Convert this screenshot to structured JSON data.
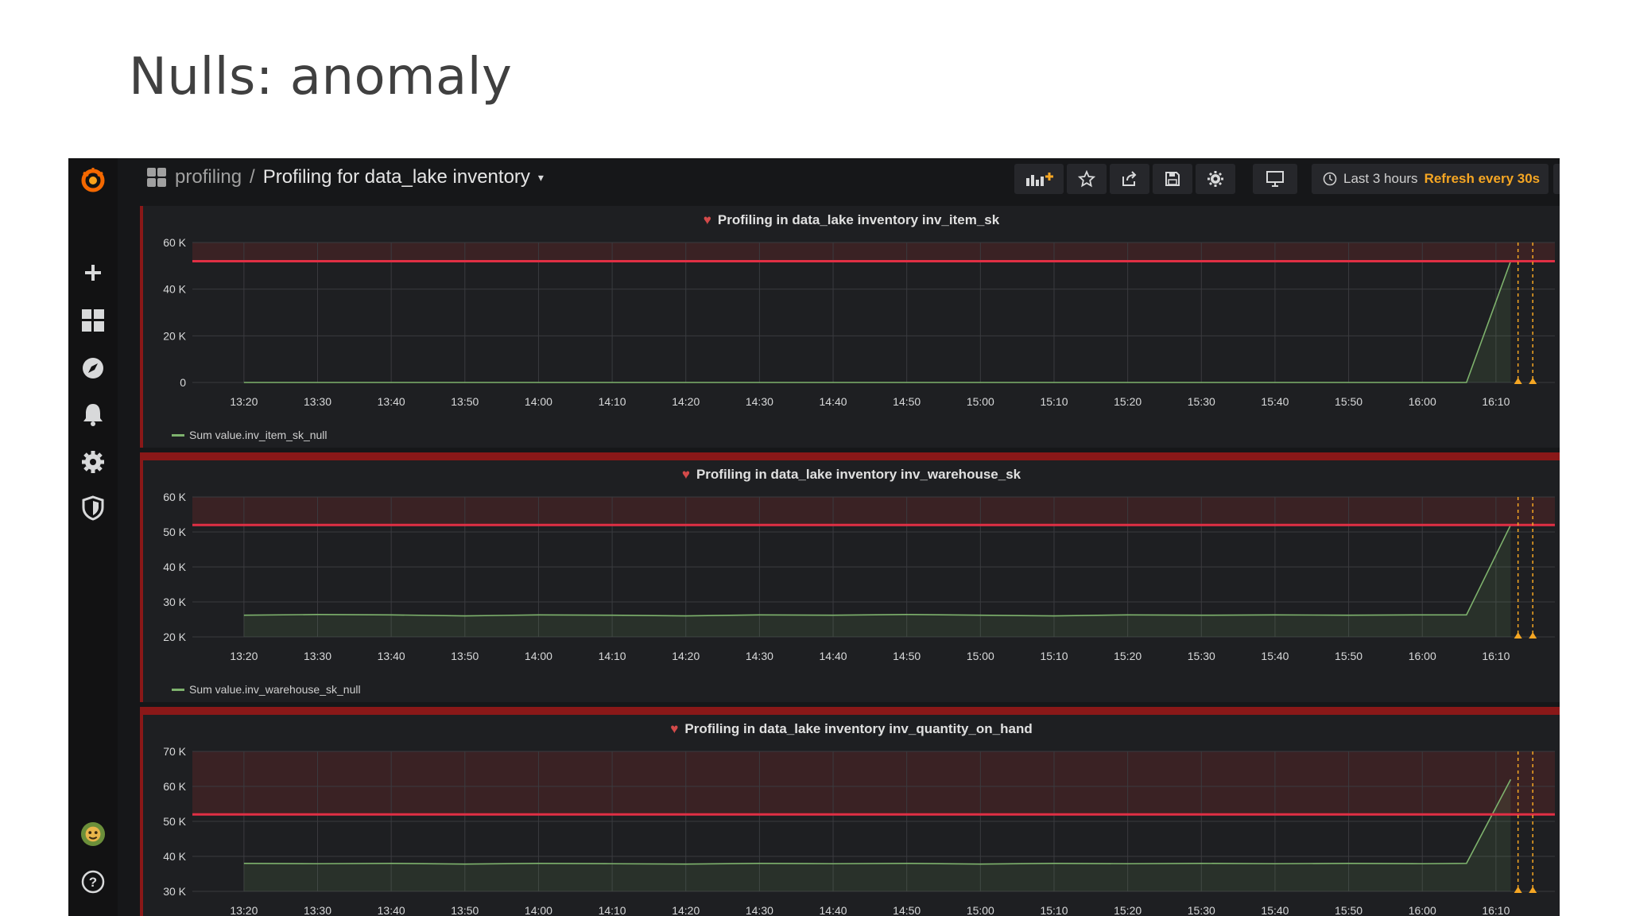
{
  "slide": {
    "title": "Nulls: anomaly"
  },
  "dashboard": {
    "folder": "profiling",
    "separator": "/",
    "name": "Profiling for data_lake inventory",
    "time_range": "Last 3 hours",
    "refresh": "Refresh every 30s"
  },
  "sidebar": {
    "icons": [
      "grafana-logo-icon",
      "plus-icon",
      "dashboards-icon",
      "explore-icon",
      "alerting-icon",
      "configuration-icon",
      "shield-icon",
      "avatar",
      "help-icon"
    ]
  },
  "toolbar": {
    "icons": [
      "add-panel-icon",
      "star-icon",
      "share-icon",
      "save-icon",
      "settings-icon",
      "tv-mode-icon",
      "clock-icon",
      "zoom-out-icon",
      "refresh-icon"
    ]
  },
  "colors": {
    "series": "#7eb26d",
    "threshold": "#e02f44",
    "alert_region": "#3a2224",
    "grid": "#3a3b3f"
  },
  "chart_data": [
    {
      "type": "area",
      "title": "Profiling in data_lake inventory inv_item_sk",
      "series_name": "Sum value.inv_item_sk_null",
      "x_ticks": [
        "13:20",
        "13:30",
        "13:40",
        "13:50",
        "14:00",
        "14:10",
        "14:20",
        "14:30",
        "14:40",
        "14:50",
        "15:00",
        "15:10",
        "15:20",
        "15:30",
        "15:40",
        "15:50",
        "16:00",
        "16:10"
      ],
      "y_ticks": [
        0,
        20000,
        40000,
        60000
      ],
      "y_tick_labels": [
        "0",
        "20 K",
        "40 K",
        "60 K"
      ],
      "ylim": [
        0,
        60000
      ],
      "threshold": 52000,
      "x": [
        "13:20",
        "13:30",
        "13:40",
        "13:50",
        "14:00",
        "14:10",
        "14:20",
        "14:30",
        "14:40",
        "14:50",
        "15:00",
        "15:10",
        "15:20",
        "15:30",
        "15:40",
        "15:50",
        "16:00",
        "16:06",
        "16:12"
      ],
      "values": [
        0,
        0,
        0,
        0,
        0,
        0,
        0,
        0,
        0,
        0,
        0,
        0,
        0,
        0,
        0,
        0,
        0,
        0,
        52000
      ]
    },
    {
      "type": "area",
      "title": "Profiling in data_lake inventory inv_warehouse_sk",
      "series_name": "Sum value.inv_warehouse_sk_null",
      "x_ticks": [
        "13:20",
        "13:30",
        "13:40",
        "13:50",
        "14:00",
        "14:10",
        "14:20",
        "14:30",
        "14:40",
        "14:50",
        "15:00",
        "15:10",
        "15:20",
        "15:30",
        "15:40",
        "15:50",
        "16:00",
        "16:10"
      ],
      "y_ticks": [
        20000,
        30000,
        40000,
        50000,
        60000
      ],
      "y_tick_labels": [
        "20 K",
        "30 K",
        "40 K",
        "50 K",
        "60 K"
      ],
      "ylim": [
        20000,
        60000
      ],
      "threshold": 52000,
      "x": [
        "13:20",
        "13:30",
        "13:40",
        "13:50",
        "14:00",
        "14:10",
        "14:20",
        "14:30",
        "14:40",
        "14:50",
        "15:00",
        "15:10",
        "15:20",
        "15:30",
        "15:40",
        "15:50",
        "16:00",
        "16:06",
        "16:12"
      ],
      "values": [
        26200,
        26400,
        26300,
        26000,
        26300,
        26200,
        26000,
        26300,
        26200,
        26400,
        26200,
        26000,
        26300,
        26200,
        26300,
        26200,
        26300,
        26300,
        52000
      ]
    },
    {
      "type": "area",
      "title": "Profiling in data_lake inventory inv_quantity_on_hand",
      "series_name": "",
      "x_ticks": [
        "13:20",
        "13:30",
        "13:40",
        "13:50",
        "14:00",
        "14:10",
        "14:20",
        "14:30",
        "14:40",
        "14:50",
        "15:00",
        "15:10",
        "15:20",
        "15:30",
        "15:40",
        "15:50",
        "16:00",
        "16:10"
      ],
      "y_ticks": [
        30000,
        40000,
        50000,
        60000,
        70000
      ],
      "y_tick_labels": [
        "30 K",
        "40 K",
        "50 K",
        "60 K",
        "70 K"
      ],
      "ylim": [
        30000,
        70000
      ],
      "threshold": 52000,
      "x": [
        "13:20",
        "13:30",
        "13:40",
        "13:50",
        "14:00",
        "14:10",
        "14:20",
        "14:30",
        "14:40",
        "14:50",
        "15:00",
        "15:10",
        "15:20",
        "15:30",
        "15:40",
        "15:50",
        "16:00",
        "16:06",
        "16:12"
      ],
      "values": [
        38000,
        37900,
        38000,
        37800,
        38000,
        37900,
        37800,
        38000,
        37900,
        38000,
        37800,
        38000,
        37900,
        38000,
        37900,
        38000,
        37900,
        38000,
        62000
      ]
    }
  ]
}
